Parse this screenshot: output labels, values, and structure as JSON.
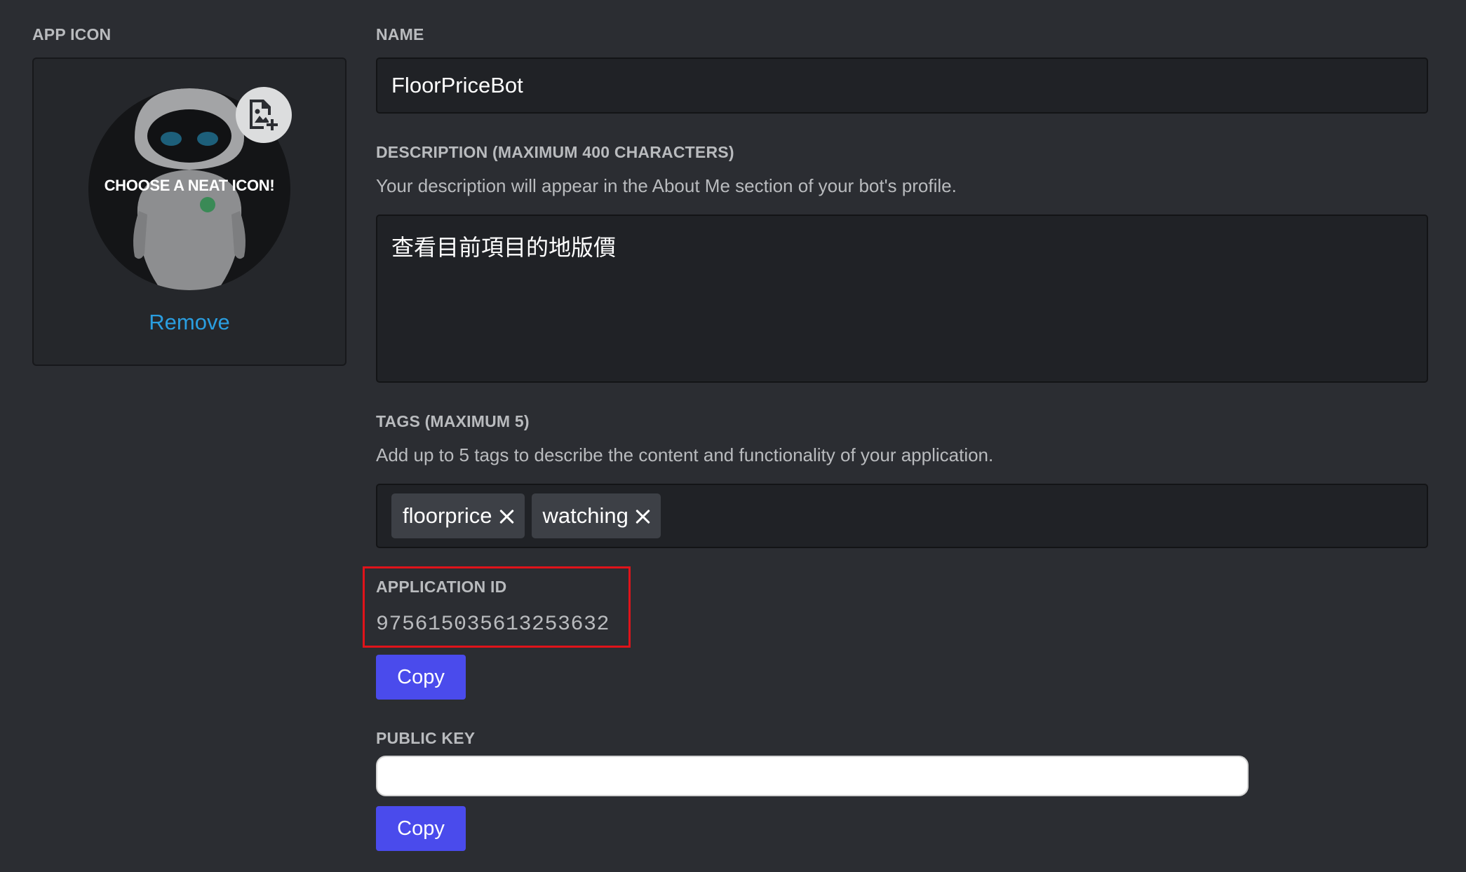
{
  "app_icon": {
    "label": "APP ICON",
    "overlay_text": "CHOOSE A NEAT ICON!",
    "remove_label": "Remove"
  },
  "name": {
    "label": "NAME",
    "value": "FloorPriceBot"
  },
  "description": {
    "label": "DESCRIPTION (MAXIMUM 400 CHARACTERS)",
    "helper": "Your description will appear in the About Me section of your bot's profile.",
    "value": "查看目前項目的地版價"
  },
  "tags": {
    "label": "TAGS (MAXIMUM 5)",
    "helper": "Add up to 5 tags to describe the content and functionality of your application.",
    "items": [
      {
        "label": "floorprice"
      },
      {
        "label": "watching"
      }
    ]
  },
  "application_id": {
    "label": "APPLICATION ID",
    "value": "975615035613253632",
    "copy_label": "Copy"
  },
  "public_key": {
    "label": "PUBLIC KEY",
    "value": "",
    "copy_label": "Copy"
  },
  "colors": {
    "background": "#2b2d32",
    "input_bg": "#202226",
    "button": "#4a4bec",
    "link": "#2a9ee0",
    "highlight": "#e0131a"
  }
}
